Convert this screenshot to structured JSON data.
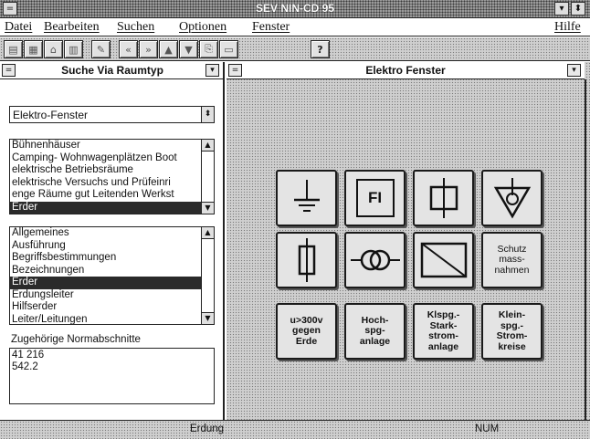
{
  "window": {
    "title": "SEV NIN-CD 95"
  },
  "menu": {
    "items": [
      "Datei",
      "Bearbeiten",
      "Suchen",
      "Optionen",
      "Fenster"
    ],
    "help": "Hilfe"
  },
  "toolbar": {
    "icons": [
      "page-icon",
      "page-icon",
      "house-icon",
      "calculator-icon",
      "pencil-icon",
      "first-page-icon",
      "last-page-icon",
      "arrow-up-icon",
      "arrow-down-icon",
      "copy-icon",
      "print-icon",
      "help-icon"
    ],
    "help_label": "?"
  },
  "left_pane": {
    "title": "Suche Via Raumtyp",
    "combo_value": "Elektro-Fenster",
    "rooms": [
      "Bühnenhäuser",
      "Camping- Wohnwagenplätzen Boot",
      "elektrische Betriebsräume",
      "elektrische Versuchs und Prüfeinri",
      "enge Räume gut Leitenden Werkst",
      "Erder"
    ],
    "rooms_selected": "Erder",
    "topics": [
      "Allgemeines",
      "Ausführung",
      "Begriffsbestimmungen",
      "Bezeichnungen",
      "Erder",
      "Erdungsleiter",
      "Hilfserder",
      "Leiter/Leitungen"
    ],
    "topics_selected": "Erder",
    "sections_label": "Zugehörige Normabschnitte",
    "sections": [
      "41 216",
      "542.2"
    ]
  },
  "right_pane": {
    "title": "Elektro Fenster",
    "buttons": [
      {
        "label": "",
        "icon": "ground-icon"
      },
      {
        "label": "FI",
        "icon": "fi-icon"
      },
      {
        "label": "",
        "icon": "switch-box-icon"
      },
      {
        "label": "",
        "icon": "triangle-circle-icon"
      },
      {
        "label": "",
        "icon": "fuse-icon"
      },
      {
        "label": "",
        "icon": "transformer-icon"
      },
      {
        "label": "",
        "icon": "converter-icon"
      },
      {
        "label": "Schutz\nmass-\nnahmen",
        "icon": ""
      },
      {
        "label": "u>300v\ngegen\nErde",
        "icon": ""
      },
      {
        "label": "Hoch-\nspg-\nanlage",
        "icon": ""
      },
      {
        "label": "Klspg.-\nStark-\nstrom-\nanlage",
        "icon": ""
      },
      {
        "label": "Klein-\nspg.-\nStrom-\nkreise",
        "icon": ""
      }
    ]
  },
  "status": {
    "left": "Erdung",
    "right": "NUM"
  },
  "colors": {
    "selection": "#2a2a2a",
    "dither": "#cfcfcf"
  }
}
